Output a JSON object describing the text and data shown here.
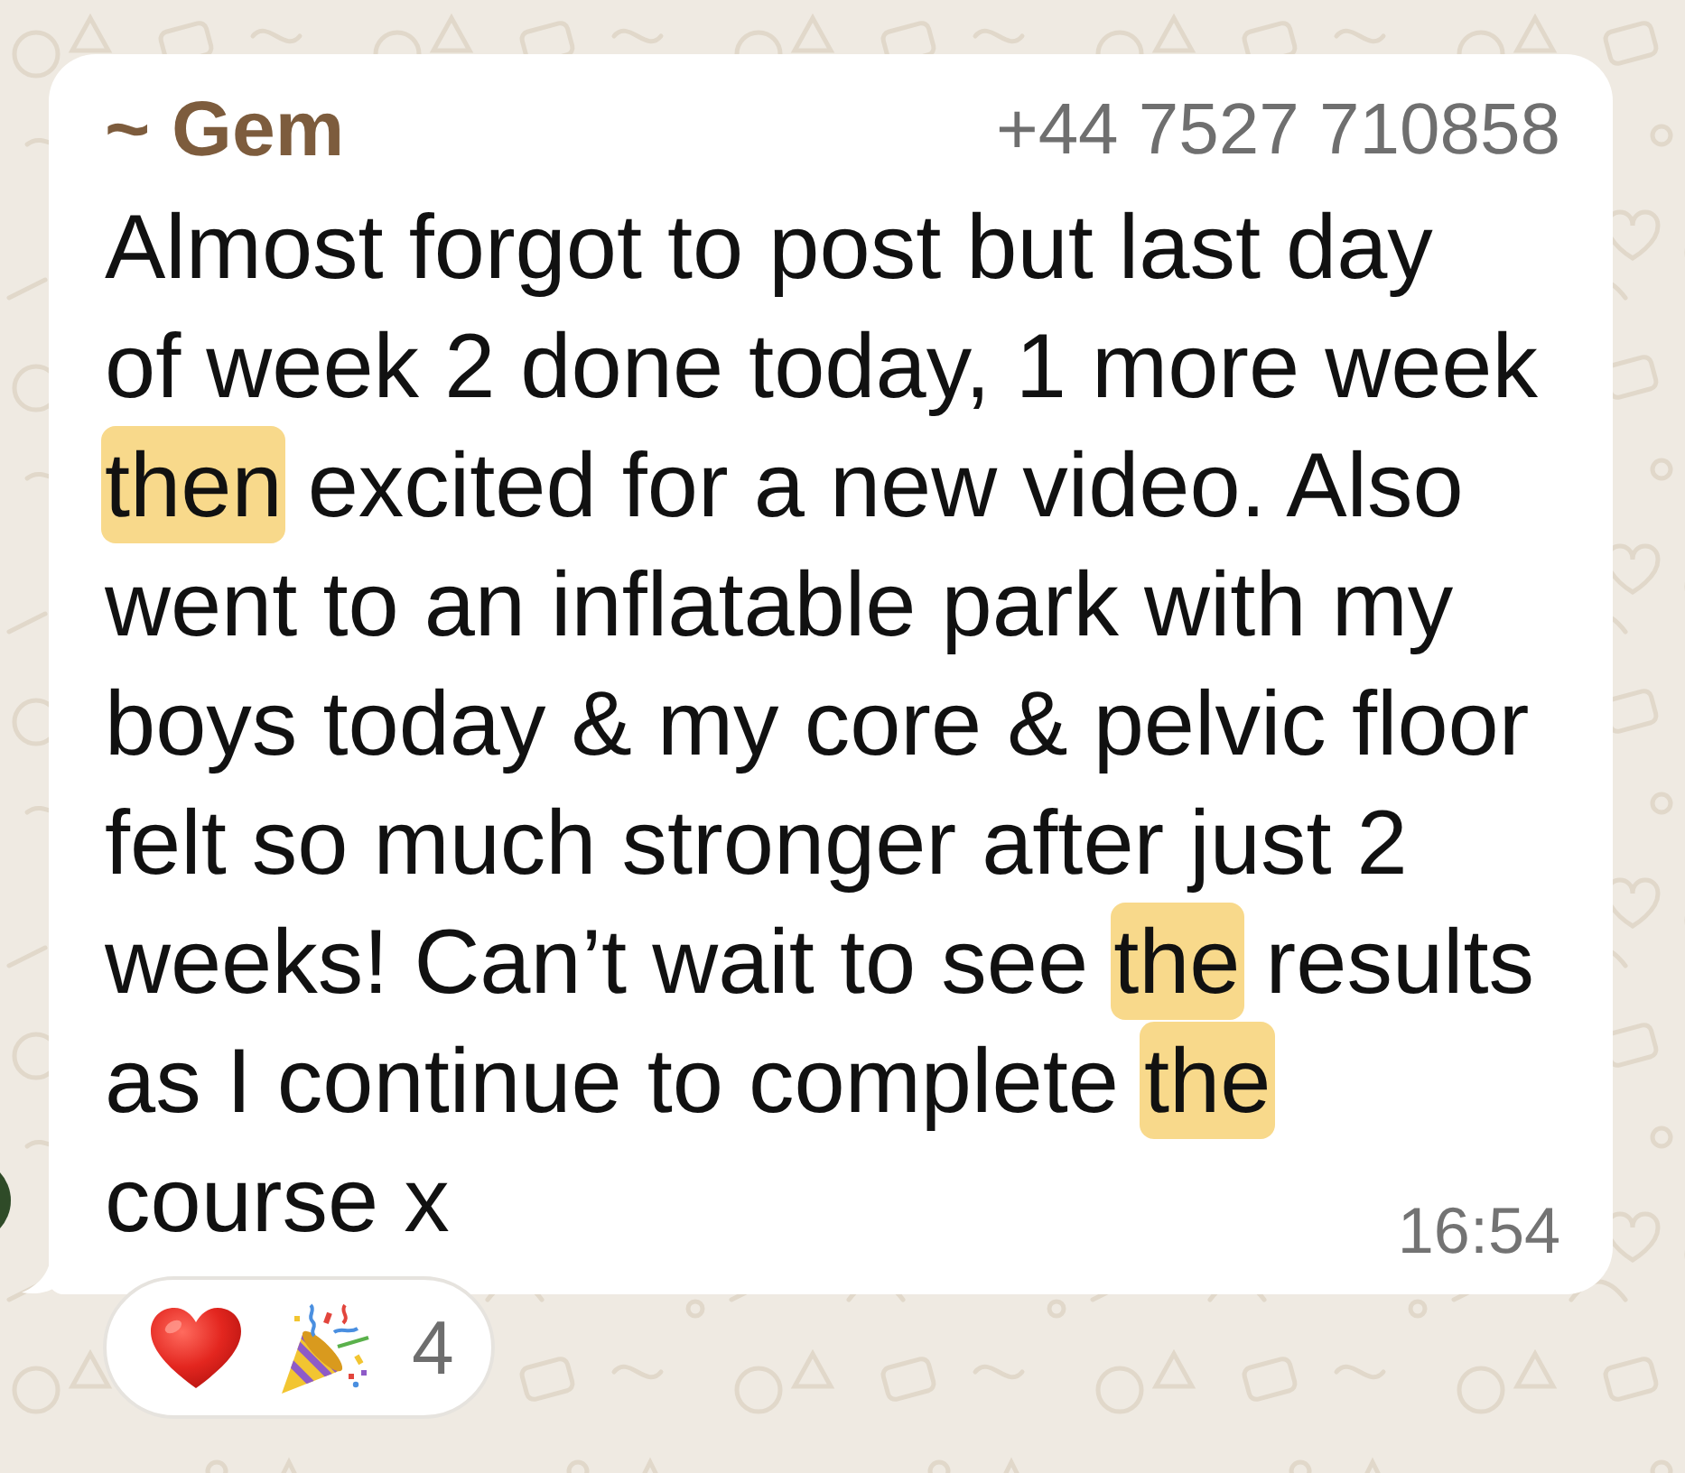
{
  "message": {
    "sender": "~ Gem",
    "phone": "+44 7527 710858",
    "segments": [
      {
        "text": "Almost forgot to post but last day\nof week 2 done today, 1 more week\n",
        "highlighted": false
      },
      {
        "text": "then",
        "highlighted": true
      },
      {
        "text": " excited for a new video. Also\nwent to an inflatable park with my\nboys today & my core & pelvic floor\nfelt so much stronger after just 2\nweeks! Can’t wait to see ",
        "highlighted": false
      },
      {
        "text": "the",
        "highlighted": true
      },
      {
        "text": " results\nas I continue to complete ",
        "highlighted": false
      },
      {
        "text": "the",
        "highlighted": true
      },
      {
        "text": "\ncourse x",
        "highlighted": false
      }
    ],
    "time": "16:54"
  },
  "reactions": {
    "items": [
      {
        "kind": "heart"
      },
      {
        "kind": "party-popper"
      }
    ],
    "count": "4"
  }
}
